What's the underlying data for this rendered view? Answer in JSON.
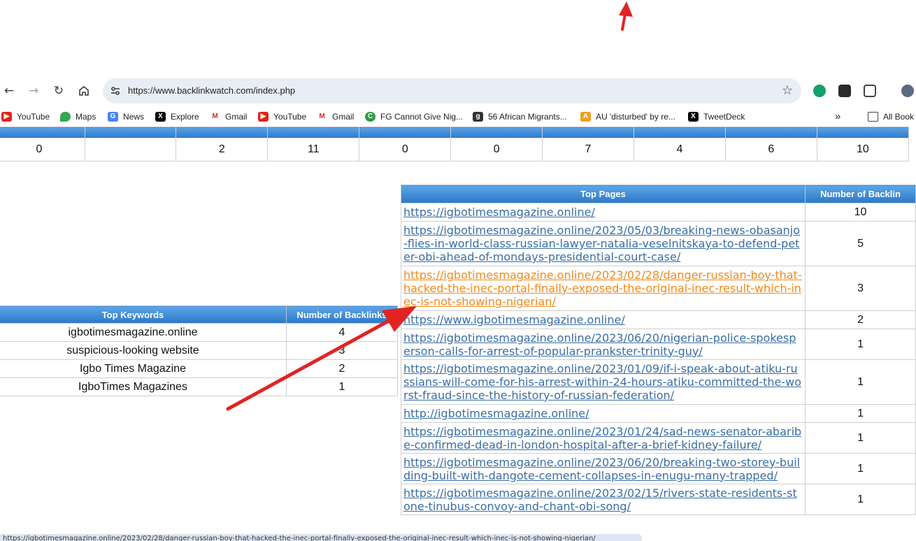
{
  "browser": {
    "url": "https://www.backlinkwatch.com/index.php",
    "icons": [
      "back-arrow-icon",
      "forward-arrow-icon",
      "reload-icon",
      "home-icon",
      "site-settings-icon",
      "bookmark-star-icon",
      "grammarly-icon",
      "extension-icon",
      "puzzle-icon",
      "profile-avatar-icon"
    ]
  },
  "bookmarks": [
    {
      "label": "YouTube",
      "icon": "youtube-icon"
    },
    {
      "label": "Maps",
      "icon": "maps-icon"
    },
    {
      "label": "News",
      "icon": "news-icon"
    },
    {
      "label": "Explore",
      "icon": "x-icon"
    },
    {
      "label": "Gmail",
      "icon": "gmail-icon"
    },
    {
      "label": "YouTube",
      "icon": "youtube-icon"
    },
    {
      "label": "Gmail",
      "icon": "gmail-icon"
    },
    {
      "label": "FG Cannot Give Nig...",
      "icon": "site-icon"
    },
    {
      "label": "56 African Migrants...",
      "icon": "g-icon"
    },
    {
      "label": "AU 'disturbed' by re...",
      "icon": "site-icon"
    },
    {
      "label": "TweetDeck",
      "icon": "x-icon"
    },
    {
      "label": "All Book",
      "icon": "folder-icon"
    }
  ],
  "stats": {
    "values": [
      "0",
      "",
      "2",
      "11",
      "0",
      "0",
      "7",
      "4",
      "6",
      "10"
    ]
  },
  "keywords": {
    "header_keyword": "Top Keywords",
    "header_count": "Number of Backlinks",
    "rows": [
      {
        "keyword": "igbotimesmagazine.online",
        "count": "4"
      },
      {
        "keyword": "suspicious-looking website",
        "count": "3"
      },
      {
        "keyword": "Igbo Times Magazine",
        "count": "2"
      },
      {
        "keyword": "IgboTimes Magazines",
        "count": "1"
      }
    ]
  },
  "top_pages": {
    "header_page": "Top Pages",
    "header_count": "Number of Backlin",
    "rows": [
      {
        "url": "https://igbotimesmagazine.online/",
        "count": "10"
      },
      {
        "url": "https://igbotimesmagazine.online/2023/05/03/breaking-news-obasanjo-flies-in-world-class-russian-lawyer-natalia-veselnitskaya-to-defend-peter-obi-ahead-of-mondays-presidential-court-case/",
        "count": "5"
      },
      {
        "url": "https://igbotimesmagazine.online/2023/02/28/danger-russian-boy-that-hacked-the-inec-portal-finally-exposed-the-original-inec-result-which-inec-is-not-showing-nigerian/",
        "count": "3"
      },
      {
        "url": "https://www.igbotimesmagazine.online/",
        "count": "2"
      },
      {
        "url": "https://igbotimesmagazine.online/2023/06/20/nigerian-police-spokesperson-calls-for-arrest-of-popular-prankster-trinity-guy/",
        "count": "1"
      },
      {
        "url": "https://igbotimesmagazine.online/2023/01/09/if-i-speak-about-atiku-russians-will-come-for-his-arrest-within-24-hours-atiku-committed-the-worst-fraud-since-the-history-of-russian-federation/",
        "count": "1"
      },
      {
        "url": "http://igbotimesmagazine.online/",
        "count": "1"
      },
      {
        "url": "https://igbotimesmagazine.online/2023/01/24/sad-news-senator-abaribe-confirmed-dead-in-london-hospital-after-a-brief-kidney-failure/",
        "count": "1"
      },
      {
        "url": "https://igbotimesmagazine.online/2023/06/20/breaking-two-storey-building-built-with-dangote-cement-collapses-in-enugu-many-trapped/",
        "count": "1"
      },
      {
        "url": "https://igbotimesmagazine.online/2023/02/15/rivers-state-residents-stone-tinubus-convoy-and-chant-obi-song/",
        "count": "1"
      }
    ]
  },
  "status_url": "https://igbotimesmagazine.online/2023/02/28/danger-russian-boy-that-hacked-the-inec-portal-finally-exposed-the-original-inec-result-which-inec-is-not-showing-nigerian/",
  "colors": {
    "header_blue": "#3b88d6",
    "link": "#3a6ea5",
    "visited_link": "#ef8a1a",
    "annotation_arrow": "#e02424"
  }
}
